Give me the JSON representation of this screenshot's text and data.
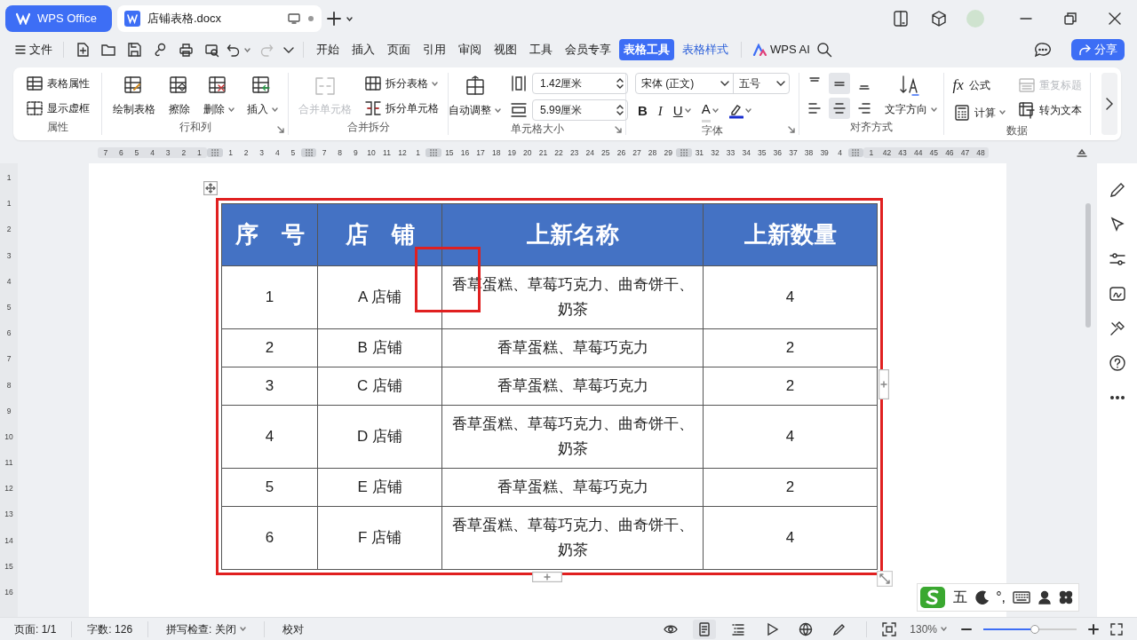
{
  "tab_bar": {
    "app_button": "WPS Office",
    "document_tab": {
      "title": "店铺表格.docx",
      "selected": true
    }
  },
  "menu_bar": {
    "file": "文件",
    "tabs": [
      {
        "label": "开始",
        "selected": false,
        "kind": "main"
      },
      {
        "label": "插入",
        "selected": false,
        "kind": "main"
      },
      {
        "label": "页面",
        "selected": false,
        "kind": "main"
      },
      {
        "label": "引用",
        "selected": false,
        "kind": "main"
      },
      {
        "label": "审阅",
        "selected": false,
        "kind": "main"
      },
      {
        "label": "视图",
        "selected": false,
        "kind": "main"
      },
      {
        "label": "工具",
        "selected": false,
        "kind": "main"
      },
      {
        "label": "会员专享",
        "selected": false,
        "kind": "main"
      },
      {
        "label": "表格工具",
        "selected": true,
        "kind": "context"
      },
      {
        "label": "表格样式",
        "selected": false,
        "kind": "context"
      }
    ],
    "ai": "WPS AI",
    "share": "分享"
  },
  "ribbon": {
    "groups": [
      {
        "label": "属性",
        "launcher": false,
        "columns": [
          [
            {
              "kind": "small",
              "label": "表格属性",
              "dropdown": false,
              "disabled": false
            },
            {
              "kind": "small",
              "label": "显示虚框",
              "dropdown": false,
              "disabled": false
            }
          ]
        ]
      },
      {
        "label": "行和列",
        "launcher": true,
        "columns": [
          [
            {
              "kind": "large",
              "label": "绘制表格",
              "dropdown": false,
              "disabled": false
            }
          ],
          [
            {
              "kind": "large",
              "label": "擦除",
              "dropdown": false,
              "disabled": false
            }
          ],
          [
            {
              "kind": "large",
              "label": "删除",
              "dropdown": true,
              "disabled": false
            }
          ],
          [
            {
              "kind": "large",
              "label": "插入",
              "dropdown": true,
              "disabled": false
            }
          ]
        ]
      },
      {
        "label": "合并拆分",
        "launcher": false,
        "columns": [
          [
            {
              "kind": "large",
              "label": "合并单元格",
              "dropdown": false,
              "disabled": true
            }
          ],
          [
            {
              "kind": "small",
              "label": "拆分表格",
              "dropdown": true,
              "disabled": false
            },
            {
              "kind": "small",
              "label": "拆分单元格",
              "dropdown": false,
              "disabled": false
            }
          ]
        ]
      },
      {
        "label": "单元格大小",
        "launcher": true,
        "columns": [
          [
            {
              "kind": "large",
              "label": "自动调整",
              "dropdown": true,
              "disabled": false
            }
          ],
          [
            {
              "kind": "spin",
              "value": "1.42厘米"
            },
            {
              "kind": "spin",
              "value": "5.99厘米"
            }
          ]
        ]
      },
      {
        "label": "字体",
        "launcher": true,
        "columns": [
          [
            {
              "kind": "fontrow",
              "font": "宋体 (正文)",
              "size": "五号"
            },
            {
              "kind": "format",
              "buttons": [
                {
                  "kind": "bold",
                  "label": "B"
                },
                {
                  "kind": "italic",
                  "label": "I"
                },
                {
                  "kind": "underline",
                  "label": "U"
                },
                {
                  "kind": "color",
                  "label": "A"
                },
                {
                  "kind": "highlight"
                }
              ]
            }
          ]
        ]
      },
      {
        "label": "对齐方式",
        "launcher": false,
        "columns": [
          [
            {
              "kind": "align",
              "cells": [
                {
                  "selected": false
                },
                {
                  "selected": true
                },
                {
                  "selected": false
                },
                {
                  "selected": false
                },
                {
                  "selected": true
                },
                {
                  "selected": false
                }
              ]
            }
          ],
          [
            {
              "kind": "direction",
              "label": "文字方向",
              "dropdown": true,
              "disabled": false
            }
          ]
        ]
      },
      {
        "label": "数据",
        "launcher": false,
        "columns": [
          [
            {
              "kind": "small",
              "glyph": "fx",
              "label": "公式",
              "dropdown": false,
              "disabled": false
            },
            {
              "kind": "small",
              "label": "计算",
              "dropdown": true,
              "disabled": false
            }
          ],
          [
            {
              "kind": "small",
              "label": "重复标题",
              "dropdown": false,
              "disabled": true
            },
            {
              "kind": "small",
              "label": "转为文本",
              "dropdown": false,
              "disabled": false
            }
          ]
        ]
      }
    ]
  },
  "ruler": {
    "horizontal": [
      [
        "7",
        "6",
        "5",
        "4",
        "3",
        "2",
        "1"
      ],
      [
        "1",
        "2",
        "3",
        "4",
        "5"
      ],
      [
        "7",
        "8",
        "9",
        "10",
        "11",
        "12",
        "1"
      ],
      [
        "15",
        "16",
        "17",
        "18",
        "19",
        "20",
        "21",
        "22",
        "23",
        "24",
        "25",
        "26",
        "27",
        "28",
        "29"
      ],
      [
        "31",
        "32",
        "33",
        "34",
        "35",
        "36",
        "37",
        "38",
        "39",
        "4"
      ],
      [
        "1",
        "42",
        "43",
        "44",
        "45",
        "46",
        "47",
        "48"
      ]
    ],
    "vertical": [
      "1",
      "1",
      "2",
      "3",
      "4",
      "5",
      "6",
      "7",
      "8",
      "9",
      "10",
      "11",
      "12",
      "13",
      "14",
      "15",
      "16"
    ]
  },
  "table": {
    "columns": [
      "序　号",
      "店　铺",
      "上新名称",
      "上新数量"
    ],
    "rows": [
      [
        "1",
        "A 店铺",
        "香草蛋糕、草莓巧克力、曲奇饼干、奶茶",
        "4"
      ],
      [
        "2",
        "B 店铺",
        "香草蛋糕、草莓巧克力",
        "2"
      ],
      [
        "3",
        "C 店铺",
        "香草蛋糕、草莓巧克力",
        "2"
      ],
      [
        "4",
        "D 店铺",
        "香草蛋糕、草莓巧克力、曲奇饼干、奶茶",
        "4"
      ],
      [
        "5",
        "E 店铺",
        "香草蛋糕、草莓巧克力",
        "2"
      ],
      [
        "6",
        "F 店铺",
        "香草蛋糕、草莓巧克力、曲奇饼干、奶茶",
        "4"
      ]
    ]
  },
  "ime": {
    "mode": "五",
    "punctuation": "°,"
  },
  "status_bar": {
    "page": "页面: 1/1",
    "words": "字数: 126",
    "spell": "拼写检查: 关闭",
    "proofread": "校对",
    "views": [
      {
        "selected": false
      },
      {
        "selected": true
      },
      {
        "selected": false
      },
      {
        "selected": false
      },
      {
        "selected": false
      },
      {
        "selected": false
      }
    ],
    "zoom": "130%",
    "zoom_slider": {
      "level": 0.55
    }
  }
}
